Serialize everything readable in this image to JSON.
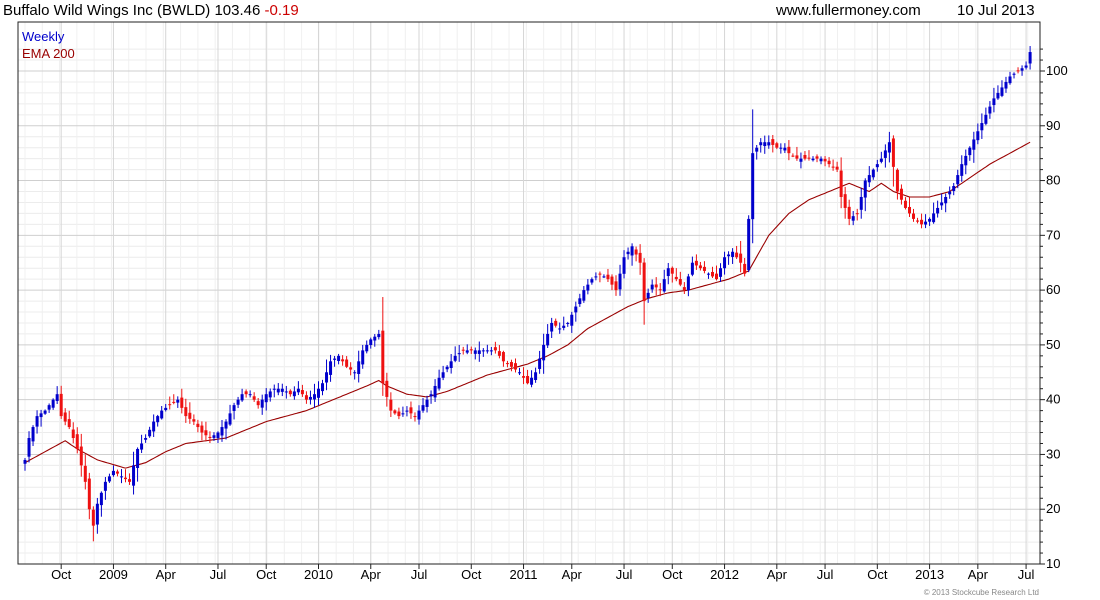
{
  "header": {
    "title": "Buffalo Wild Wings Inc (BWLD)",
    "price": "103.46",
    "change": "-0.19",
    "site": "www.fullermoney.com",
    "date": "10 Jul 2013"
  },
  "copyright": "© 2013 Stockcube Research Ltd",
  "colors": {
    "up": "#0000cc",
    "down": "#ee1111",
    "ema": "#990000",
    "grid": "#d8d8d8",
    "frame": "#222222"
  },
  "chart_data": {
    "type": "candlestick",
    "series": [
      {
        "name": "Weekly",
        "color": "#0000cc"
      },
      {
        "name": "EMA 200",
        "color": "#990000"
      }
    ],
    "grid": true,
    "legend_position": "top-left",
    "y_axis": {
      "side": "right",
      "ylim": [
        10,
        106
      ],
      "ticks": [
        10,
        20,
        30,
        40,
        50,
        60,
        70,
        80,
        90,
        100
      ]
    },
    "x_axis": {
      "xlim": [
        0,
        245
      ],
      "ticks": [
        {
          "label": "Oct",
          "week": 9
        },
        {
          "label": "2009",
          "week": 22
        },
        {
          "label": "Apr",
          "week": 35
        },
        {
          "label": "Jul",
          "week": 48
        },
        {
          "label": "Oct",
          "week": 60
        },
        {
          "label": "2010",
          "week": 73
        },
        {
          "label": "Apr",
          "week": 86
        },
        {
          "label": "Jul",
          "week": 98
        },
        {
          "label": "Oct",
          "week": 111
        },
        {
          "label": "2011",
          "week": 124
        },
        {
          "label": "Apr",
          "week": 136
        },
        {
          "label": "Jul",
          "week": 149
        },
        {
          "label": "Oct",
          "week": 161
        },
        {
          "label": "2012",
          "week": 174
        },
        {
          "label": "Apr",
          "week": 187
        },
        {
          "label": "Jul",
          "week": 199
        },
        {
          "label": "Oct",
          "week": 212
        },
        {
          "label": "2013",
          "week": 225
        },
        {
          "label": "Apr",
          "week": 237
        },
        {
          "label": "Jul",
          "week": 249
        }
      ]
    },
    "close_anchors": [
      [
        0,
        29
      ],
      [
        1,
        33
      ],
      [
        3,
        37
      ],
      [
        5,
        38
      ],
      [
        7,
        40
      ],
      [
        8,
        41
      ],
      [
        9,
        37
      ],
      [
        11,
        35
      ],
      [
        13,
        31
      ],
      [
        15,
        25
      ],
      [
        16,
        20
      ],
      [
        17,
        17
      ],
      [
        18,
        21
      ],
      [
        20,
        25
      ],
      [
        22,
        27
      ],
      [
        24,
        26
      ],
      [
        26,
        25
      ],
      [
        27,
        28
      ],
      [
        28,
        31
      ],
      [
        30,
        33
      ],
      [
        32,
        36
      ],
      [
        34,
        38
      ],
      [
        36,
        39
      ],
      [
        38,
        40
      ],
      [
        40,
        37
      ],
      [
        42,
        36
      ],
      [
        44,
        34
      ],
      [
        46,
        33
      ],
      [
        48,
        34
      ],
      [
        50,
        36
      ],
      [
        52,
        39
      ],
      [
        54,
        41
      ],
      [
        56,
        41
      ],
      [
        58,
        39
      ],
      [
        60,
        41
      ],
      [
        62,
        42
      ],
      [
        64,
        42
      ],
      [
        66,
        41
      ],
      [
        68,
        42
      ],
      [
        70,
        40
      ],
      [
        72,
        41
      ],
      [
        74,
        43
      ],
      [
        76,
        47
      ],
      [
        78,
        48
      ],
      [
        80,
        46
      ],
      [
        82,
        45
      ],
      [
        84,
        49
      ],
      [
        86,
        51
      ],
      [
        88,
        52
      ],
      [
        89,
        43
      ],
      [
        91,
        38
      ],
      [
        93,
        37
      ],
      [
        95,
        38
      ],
      [
        97,
        37
      ],
      [
        99,
        39
      ],
      [
        101,
        41
      ],
      [
        103,
        44
      ],
      [
        105,
        46
      ],
      [
        107,
        48
      ],
      [
        109,
        49
      ],
      [
        111,
        49
      ],
      [
        113,
        49
      ],
      [
        115,
        49
      ],
      [
        117,
        49
      ],
      [
        119,
        47
      ],
      [
        121,
        46
      ],
      [
        123,
        45
      ],
      [
        125,
        43
      ],
      [
        127,
        45
      ],
      [
        129,
        50
      ],
      [
        131,
        54
      ],
      [
        133,
        53
      ],
      [
        135,
        54
      ],
      [
        137,
        57
      ],
      [
        139,
        60
      ],
      [
        141,
        62
      ],
      [
        143,
        63
      ],
      [
        145,
        62
      ],
      [
        147,
        60
      ],
      [
        149,
        66
      ],
      [
        151,
        68
      ],
      [
        153,
        65
      ],
      [
        154,
        58
      ],
      [
        156,
        61
      ],
      [
        158,
        60
      ],
      [
        160,
        64
      ],
      [
        162,
        62
      ],
      [
        164,
        60
      ],
      [
        166,
        65
      ],
      [
        168,
        64
      ],
      [
        170,
        63
      ],
      [
        172,
        62
      ],
      [
        174,
        66
      ],
      [
        176,
        67
      ],
      [
        178,
        65
      ],
      [
        179,
        63
      ],
      [
        180,
        73
      ],
      [
        181,
        85
      ],
      [
        183,
        87
      ],
      [
        185,
        87
      ],
      [
        187,
        86
      ],
      [
        189,
        86
      ],
      [
        190,
        85
      ],
      [
        192,
        84
      ],
      [
        194,
        84
      ],
      [
        196,
        84
      ],
      [
        198,
        84
      ],
      [
        200,
        83
      ],
      [
        202,
        82
      ],
      [
        203,
        77
      ],
      [
        205,
        73
      ],
      [
        207,
        74
      ],
      [
        209,
        80
      ],
      [
        211,
        82
      ],
      [
        213,
        84
      ],
      [
        215,
        87
      ],
      [
        217,
        78
      ],
      [
        219,
        75
      ],
      [
        221,
        73
      ],
      [
        223,
        72
      ],
      [
        225,
        73
      ],
      [
        227,
        75
      ],
      [
        229,
        77
      ],
      [
        231,
        79
      ],
      [
        233,
        83
      ],
      [
        235,
        86
      ],
      [
        237,
        89
      ],
      [
        239,
        92
      ],
      [
        241,
        95
      ],
      [
        243,
        97
      ],
      [
        245,
        99
      ],
      [
        247,
        100
      ],
      [
        249,
        101
      ],
      [
        250,
        103.46
      ]
    ],
    "ema200_anchors": [
      [
        0,
        28.5
      ],
      [
        5,
        30.5
      ],
      [
        10,
        32.5
      ],
      [
        13,
        31
      ],
      [
        18,
        29
      ],
      [
        25,
        27.5
      ],
      [
        30,
        28.5
      ],
      [
        35,
        30.5
      ],
      [
        40,
        32
      ],
      [
        45,
        32.5
      ],
      [
        50,
        33
      ],
      [
        55,
        34.5
      ],
      [
        60,
        36
      ],
      [
        65,
        37
      ],
      [
        70,
        38
      ],
      [
        75,
        39.5
      ],
      [
        80,
        41
      ],
      [
        85,
        42.5
      ],
      [
        88,
        43.5
      ],
      [
        90,
        42.5
      ],
      [
        95,
        41
      ],
      [
        100,
        40.5
      ],
      [
        105,
        41.5
      ],
      [
        110,
        43
      ],
      [
        115,
        44.5
      ],
      [
        120,
        45.5
      ],
      [
        125,
        46.5
      ],
      [
        130,
        48
      ],
      [
        135,
        50
      ],
      [
        140,
        53
      ],
      [
        145,
        55
      ],
      [
        150,
        57
      ],
      [
        155,
        58.5
      ],
      [
        160,
        59.5
      ],
      [
        165,
        60
      ],
      [
        170,
        61
      ],
      [
        175,
        62
      ],
      [
        180,
        63.5
      ],
      [
        185,
        70
      ],
      [
        190,
        74
      ],
      [
        195,
        76.5
      ],
      [
        200,
        78
      ],
      [
        205,
        79.5
      ],
      [
        210,
        78
      ],
      [
        213,
        79.5
      ],
      [
        216,
        78
      ],
      [
        220,
        77
      ],
      [
        225,
        77
      ],
      [
        230,
        78
      ],
      [
        235,
        80.5
      ],
      [
        240,
        83
      ],
      [
        245,
        85
      ],
      [
        250,
        87
      ]
    ]
  }
}
